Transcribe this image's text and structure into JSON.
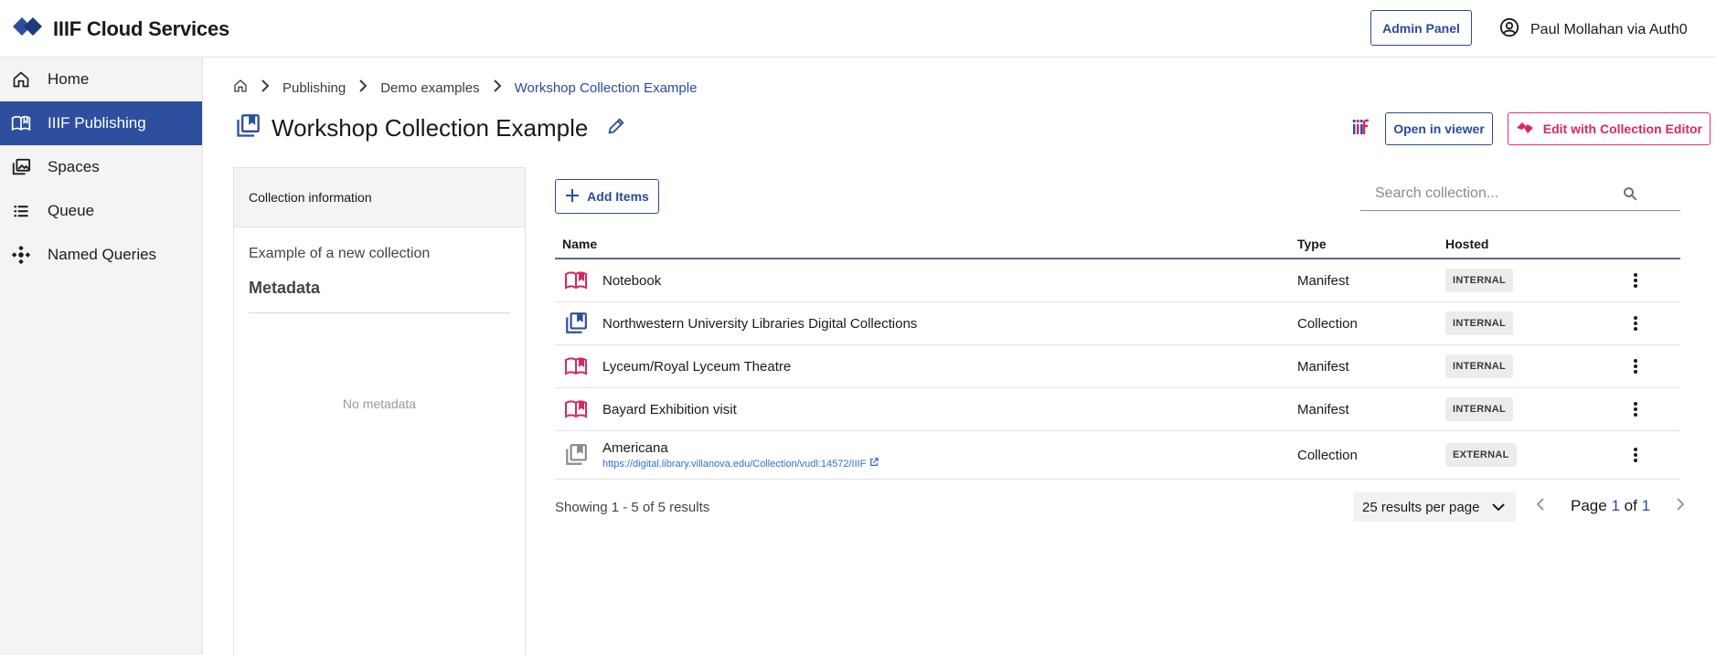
{
  "header": {
    "app_title": "IIIF Cloud Services",
    "admin_label": "Admin Panel",
    "user_label": "Paul Mollahan via Auth0"
  },
  "sidebar": {
    "items": [
      {
        "label": "Home",
        "icon": "home-icon"
      },
      {
        "label": "IIIF Publishing",
        "icon": "open-book-icon",
        "active": true
      },
      {
        "label": "Spaces",
        "icon": "photo-library-icon"
      },
      {
        "label": "Queue",
        "icon": "list-icon"
      },
      {
        "label": "Named Queries",
        "icon": "hub-icon"
      }
    ]
  },
  "breadcrumb": {
    "items": [
      "Publishing",
      "Demo examples"
    ],
    "current": "Workshop Collection Example"
  },
  "page": {
    "title": "Workshop Collection Example",
    "open_viewer_label": "Open in viewer",
    "edit_collection_label": "Edit with Collection Editor"
  },
  "info_panel": {
    "heading": "Collection information",
    "description": "Example of a new collection",
    "metadata_heading": "Metadata",
    "no_metadata": "No metadata"
  },
  "toolbar": {
    "add_items_label": "Add Items",
    "search_placeholder": "Search collection..."
  },
  "table": {
    "columns": [
      "Name",
      "Type",
      "Hosted"
    ],
    "rows": [
      {
        "name": "Notebook",
        "type": "Manifest",
        "hosted": "INTERNAL",
        "icon": "manifest-icon",
        "link": ""
      },
      {
        "name": "Northwestern University Libraries Digital Collections",
        "type": "Collection",
        "hosted": "INTERNAL",
        "icon": "collection-icon",
        "link": ""
      },
      {
        "name": "Lyceum/Royal Lyceum Theatre",
        "type": "Manifest",
        "hosted": "INTERNAL",
        "icon": "manifest-icon",
        "link": ""
      },
      {
        "name": "Bayard Exhibition visit",
        "type": "Manifest",
        "hosted": "INTERNAL",
        "icon": "manifest-icon",
        "link": ""
      },
      {
        "name": "Americana",
        "type": "Collection",
        "hosted": "EXTERNAL",
        "icon": "external-collection-icon",
        "link": "https://digital.library.villanova.edu/Collection/vudl:14572/IIIF"
      }
    ]
  },
  "footer": {
    "showing": "Showing 1 - 5 of 5 results",
    "per_page": "25 results per page",
    "page_prefix": "Page",
    "page_current": "1",
    "page_of": "of",
    "page_total": "1"
  },
  "colors": {
    "brand_blue": "#2d4f9e",
    "manifest_pink": "#d6295f",
    "link_blue": "#2e6fd6"
  }
}
